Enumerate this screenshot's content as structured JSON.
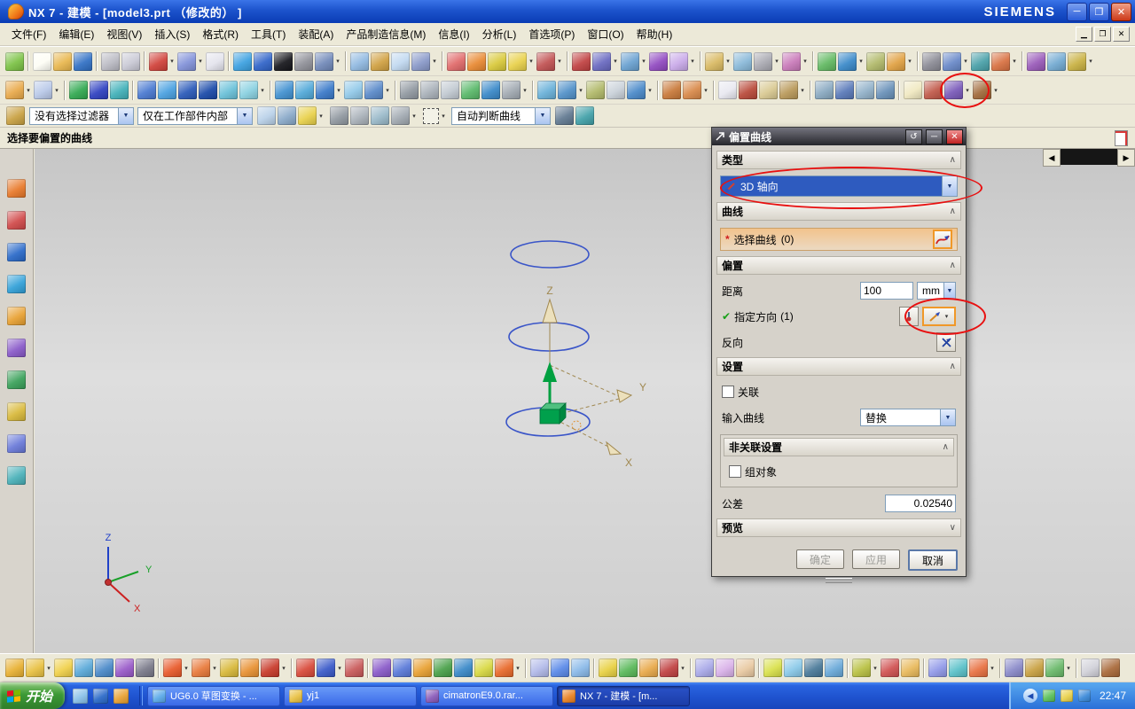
{
  "window": {
    "title": "NX 7 - 建模 - [model3.prt （修改的） ]",
    "brand": "SIEMENS",
    "min": "─",
    "max": "❐",
    "close": "✕"
  },
  "menubar": {
    "items": [
      "文件(F)",
      "编辑(E)",
      "视图(V)",
      "插入(S)",
      "格式(R)",
      "工具(T)",
      "装配(A)",
      "产品制造信息(M)",
      "信息(I)",
      "分析(L)",
      "首选项(P)",
      "窗口(O)",
      "帮助(H)"
    ]
  },
  "selection_bar": {
    "filter_label": "没有选择过滤器",
    "scope_label": "仅在工作部件内部",
    "curve_rule": "自动判断曲线"
  },
  "prompt": "选择要偏置的曲线",
  "dialog": {
    "title": "偏置曲线",
    "reset_icon": "↺",
    "min_icon": "─",
    "close_icon": "✕",
    "sections": {
      "type": "类型",
      "curve": "曲线",
      "offset": "偏置",
      "settings": "设置",
      "preview": "预览"
    },
    "chevron_up": "∧",
    "chevron_down": "∨",
    "type_value": "3D 轴向",
    "asterisk": "*",
    "select_curve": "选择曲线",
    "curve_count": "(0)",
    "distance_label": "距离",
    "distance_value": "100",
    "distance_unit": "mm",
    "direction_check": "✔",
    "direction_label": "指定方向",
    "direction_count": "(1)",
    "reverse_label": "反向",
    "assoc_label": "关联",
    "input_curve_label": "输入曲线",
    "input_curve_value": "替换",
    "nonassoc_header": "非关联设置",
    "group_label": "组对象",
    "tolerance_label": "公差",
    "tolerance_value": "0.02540",
    "ok": "确定",
    "apply": "应用",
    "cancel": "取消"
  },
  "viewport": {
    "wcs": {
      "z": "Z",
      "y": "Y",
      "x": "X"
    },
    "triad": {
      "z": "Z",
      "y": "Y",
      "x": "X"
    }
  },
  "taskbar": {
    "start": "开始",
    "tasks": [
      {
        "label": "UG6.0 草图变换 - ..."
      },
      {
        "label": "yj1"
      },
      {
        "label": "cimatronE9.0.rar..."
      },
      {
        "label": "NX 7 - 建模 - [m..."
      }
    ],
    "time": "22:47"
  },
  "icons": {
    "row1": [
      "#7ac143",
      "|",
      "#fdfdf5",
      "#e8b64c",
      "#2f6fc4",
      "|",
      "#b9b9c2",
      "#c8c8d4",
      "|",
      "#d04038*",
      "#8090d8*",
      "#e3e3ec",
      "|",
      "#3aa0e0",
      "#2f63c8",
      "#15151a",
      "#8f9098",
      "#7088b8*",
      "|",
      "#8fb8e0",
      "#d0a040",
      "#c0d8f0",
      "#8898c8*",
      "|",
      "#e06868",
      "#e88830",
      "#d8c838",
      "#e8d048*",
      "#c05050*",
      "|",
      "#c04040",
      "#6868c0*",
      "#68a0d0*",
      "#9048c0",
      "#c8a8e8*",
      "|",
      "#d8b860*",
      "#88b8d8",
      "#a8a8b0*",
      "#c878b8*",
      "|",
      "#60b860",
      "#3888c8*",
      "#b0b868",
      "#e0a040*",
      "|",
      "#8a8a94",
      "#6888c8*",
      "#48a0a8",
      "#d87040*",
      "|",
      "#9858b8",
      "#70a8d0",
      "#c8b040*"
    ],
    "row2": [
      "#e8a848*",
      "#b8c8e8*",
      "|",
      "#2fa84f",
      "#2d3fc0",
      "#3fb0b8",
      "|",
      "#4878d0",
      "#48a0e0",
      "#2858b8",
      "#1848a8",
      "#68c0d8",
      "#88d0e0*",
      "|",
      "#4090d0",
      "#50a8d8",
      "#3878c8*",
      "#90c8e8",
      "#5888c8*",
      "|",
      "#9098a0",
      "#a8b0b8",
      "#c0c8d0",
      "#58b868",
      "#3888c8",
      "#a0a8b0*",
      "|",
      "#68b0d8",
      "#5090c8*",
      "#b0b868",
      "#c8d0d8",
      "#4888c8*",
      "|",
      "#c87838",
      "#d88848*",
      "|",
      "#e8e8f0",
      "#b84838",
      "#d8c890",
      "#b89858*",
      "|",
      "#88a8c0",
      "#5878b8",
      "#90b0c8",
      "#6890b8",
      "|",
      "#f0e8c0",
      "#c05848",
      "#7858b8*",
      "#a06838*"
    ],
    "bottom": [
      "#e8b030",
      "#e8c040*",
      "#f0d048",
      "#58a8d8",
      "#4888c8",
      "#9858c8",
      "#787888",
      "|",
      "#e85828*",
      "#e87838*",
      "#d8b838",
      "#e89030",
      "#c83828*",
      "|",
      "#d84838",
      "#3858c8*",
      "#c85858",
      "|",
      "#8858c8",
      "#5878d8",
      "#e8a030",
      "#48a048",
      "#3888c8",
      "#d8d840",
      "#e86828*",
      "|",
      "#b0b8e8",
      "#5888e8",
      "#88b8e8",
      "|",
      "#e8d040",
      "#58b858",
      "#e8a848",
      "#c04040*",
      "|",
      "#a8a8e8",
      "#d8b0e8",
      "#e8c8a0",
      "|",
      "#d8e048",
      "#88c8e8",
      "#487898",
      "#68a8d8",
      "|",
      "#b8c040*",
      "#d05050",
      "#e8b858",
      "|",
      "#9098e8",
      "#58c0c8",
      "#e87040*",
      "|",
      "#8888c8",
      "#c8a040",
      "#68b868*",
      "|",
      "#d0d0d8",
      "#a86838"
    ],
    "left": [
      "#e87828",
      "#d04848",
      "#2868c8",
      "#30a0d8",
      "#e8a030",
      "#8858c8",
      "#38a058",
      "#d8b838",
      "#6878d8",
      "#48b0b8"
    ],
    "sel_a": [
      "#c8a040"
    ],
    "sel_b": [
      "#b8d0e8",
      "#88a8c8",
      "#e8d048*"
    ],
    "sel_c": [
      "#9098a0",
      "#a8b0b8",
      "#98b8c8",
      "#a0a8b0*"
    ],
    "sel_d": [
      "#607890",
      "#40a0a8"
    ],
    "quick": [
      "#88c0e8",
      "#2868c8",
      "#e8a030"
    ],
    "tray": [
      "#58c058",
      "#e8d048",
      "#3888d8"
    ]
  }
}
